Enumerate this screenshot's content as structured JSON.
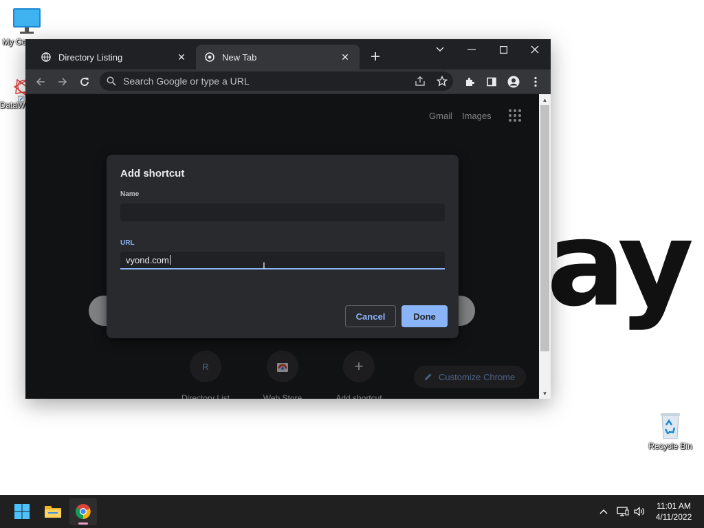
{
  "desktop": {
    "icons": [
      {
        "label": "My Co"
      },
      {
        "label": "DataW"
      },
      {
        "label": "Recycle Bin"
      }
    ],
    "wallpaper_text": "ay"
  },
  "browser": {
    "tabs": [
      {
        "title": "Directory Listing",
        "active": false
      },
      {
        "title": "New Tab",
        "active": true
      }
    ],
    "omnibox_placeholder": "Search Google or type a URL",
    "page": {
      "links": {
        "gmail": "Gmail",
        "images": "Images"
      },
      "shortcuts": [
        {
          "letter": "R",
          "label": "Directory List"
        },
        {
          "letter": "",
          "label": "Web Store"
        },
        {
          "letter": "+",
          "label": "Add shortcut"
        }
      ],
      "customize_label": "Customize Chrome"
    }
  },
  "dialog": {
    "title": "Add shortcut",
    "name_label": "Name",
    "name_value": "",
    "url_label": "URL",
    "url_value": "vyond.com",
    "cancel_label": "Cancel",
    "done_label": "Done"
  },
  "taskbar": {
    "time": "11:01 AM",
    "date": "4/11/2022"
  },
  "colors": {
    "accent": "#8ab4f8",
    "dark_bg": "#202124",
    "toolbar_bg": "#35363a",
    "dialog_bg": "#292a2d"
  }
}
